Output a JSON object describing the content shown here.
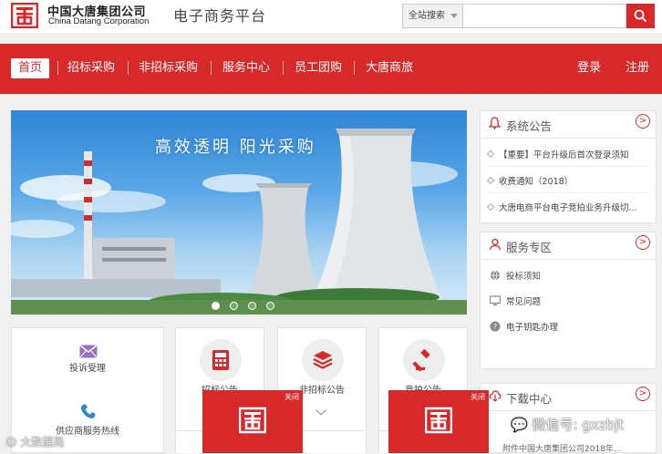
{
  "brand": {
    "name_cn": "中国大唐集团公司",
    "name_en": "China Datang Corporation",
    "site_name": "电子商务平台"
  },
  "search": {
    "scope_label": "全站搜索",
    "placeholder": ""
  },
  "nav": {
    "items": [
      {
        "label": "首页",
        "active": true
      },
      {
        "label": "招标采购"
      },
      {
        "label": "非招标采购"
      },
      {
        "label": "服务中心"
      },
      {
        "label": "员工团购"
      },
      {
        "label": "大唐商旅"
      }
    ],
    "login_label": "登录",
    "register_label": "注册"
  },
  "banner": {
    "slogan": "高效透明  阳光采购",
    "slide_count": 4,
    "current_slide": 1
  },
  "announcements": {
    "title": "系统公告",
    "more_label": ">",
    "items": [
      "【重要】平台升级后首次登录须知",
      "收费通知（2018）",
      "大唐电商平台电子竞拍业务升级切..."
    ]
  },
  "services": {
    "title": "服务专区",
    "more_label": ">",
    "items": [
      "投标须知",
      "常见问题",
      "电子钥匙办理"
    ]
  },
  "downloads": {
    "title": "下载中心",
    "more_label": ">",
    "partial_item": "附件中国大唐集团公司2018年..."
  },
  "tiles": {
    "complaint": "投诉受理",
    "hotline": "供应商服务热线",
    "bidding": "招标公告",
    "non_bidding": "非招标公告",
    "auction": "竞拍公告"
  },
  "float_ads": {
    "close_label": "关闭"
  },
  "watermarks": {
    "left": "大数据局",
    "right": "微信号: gxzbjt"
  },
  "colors": {
    "brand_red": "#d7282a",
    "nav_text": "#ffffff"
  }
}
